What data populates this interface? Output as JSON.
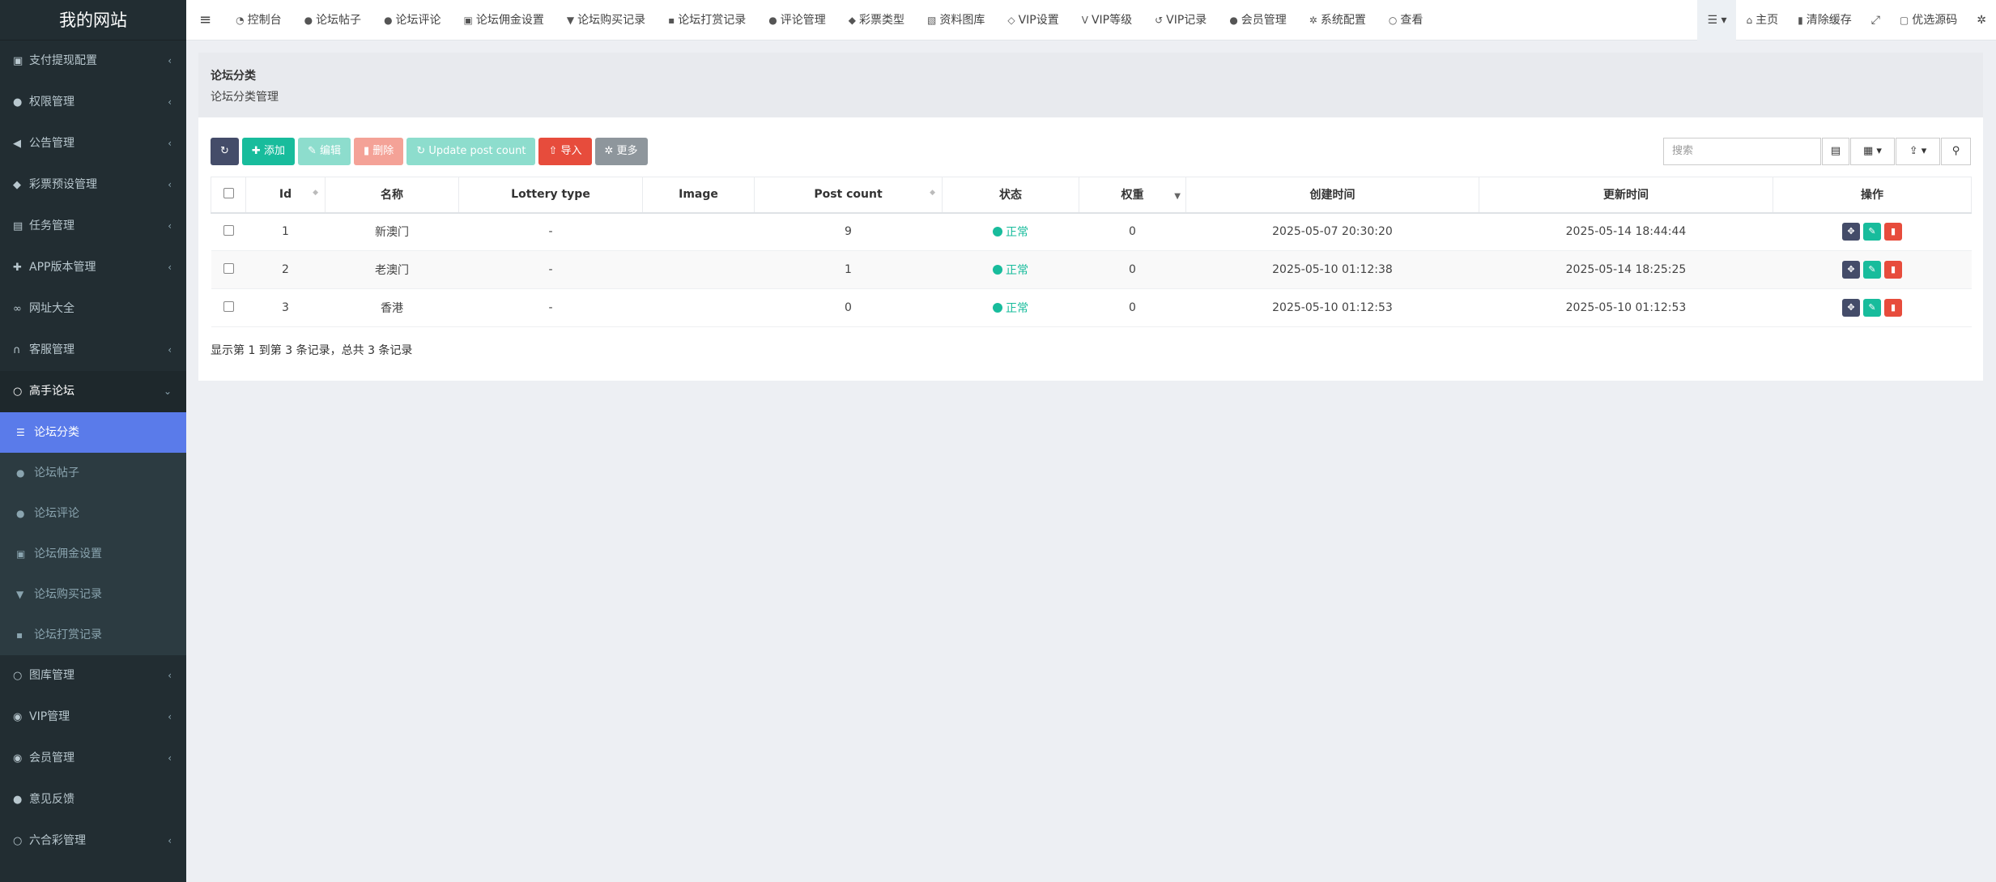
{
  "brand": "我的网站",
  "sidebar": {
    "top": [
      {
        "label": "支付提现配置",
        "icon": "money-icon"
      },
      {
        "label": "权限管理",
        "icon": "users-icon"
      },
      {
        "label": "公告管理",
        "icon": "bullhorn-icon"
      },
      {
        "label": "彩票预设管理",
        "icon": "ticket-icon"
      },
      {
        "label": "任务管理",
        "icon": "list-icon"
      },
      {
        "label": "APP版本管理",
        "icon": "puzzle-icon"
      },
      {
        "label": "网址大全",
        "icon": "link-icon"
      },
      {
        "label": "客服管理",
        "icon": "headset-icon"
      }
    ],
    "open": {
      "label": "高手论坛",
      "icon": "circle-icon"
    },
    "sub": [
      {
        "label": "论坛分类",
        "icon": "list-icon"
      },
      {
        "label": "论坛帖子",
        "icon": "comment-icon"
      },
      {
        "label": "论坛评论",
        "icon": "comments-icon"
      },
      {
        "label": "论坛佣金设置",
        "icon": "money-icon"
      },
      {
        "label": "论坛购买记录",
        "icon": "cart-icon"
      },
      {
        "label": "论坛打赏记录",
        "icon": "gift-icon"
      }
    ],
    "bottom": [
      {
        "label": "图库管理",
        "icon": "circle-icon"
      },
      {
        "label": "VIP管理",
        "icon": "vip-icon"
      },
      {
        "label": "会员管理",
        "icon": "user-icon"
      },
      {
        "label": "意见反馈",
        "icon": "comment-icon"
      },
      {
        "label": "六合彩管理",
        "icon": "circle-icon"
      }
    ]
  },
  "topnav": [
    {
      "label": "控制台",
      "icon": "dashboard-icon",
      "glyph": "◔"
    },
    {
      "label": "论坛帖子",
      "icon": "comment-icon",
      "glyph": "●"
    },
    {
      "label": "论坛评论",
      "icon": "comments-icon",
      "glyph": "●"
    },
    {
      "label": "论坛佣金设置",
      "icon": "money-icon",
      "glyph": "▣"
    },
    {
      "label": "论坛购买记录",
      "icon": "cart-icon",
      "glyph": "▼"
    },
    {
      "label": "论坛打赏记录",
      "icon": "gift-icon",
      "glyph": "▪"
    },
    {
      "label": "评论管理",
      "icon": "comments-icon",
      "glyph": "●"
    },
    {
      "label": "彩票类型",
      "icon": "ticket-icon",
      "glyph": "◆"
    },
    {
      "label": "资料图库",
      "icon": "image-icon",
      "glyph": "▧"
    },
    {
      "label": "VIP设置",
      "icon": "diamond-icon",
      "glyph": "◇"
    },
    {
      "label": "VIP等级",
      "icon": "vip-icon",
      "glyph": "V"
    },
    {
      "label": "VIP记录",
      "icon": "history-icon",
      "glyph": "↺"
    },
    {
      "label": "会员管理",
      "icon": "user-icon",
      "glyph": "●"
    },
    {
      "label": "系统配置",
      "icon": "gear-icon",
      "glyph": "✲"
    },
    {
      "label": "查看",
      "icon": "circle-icon",
      "glyph": "○"
    }
  ],
  "topright": {
    "home": "主页",
    "clear_cache": "清除缓存",
    "source": "优选源码"
  },
  "page": {
    "title": "论坛分类",
    "subtitle": "论坛分类管理"
  },
  "toolbar": {
    "add": "添加",
    "edit": "编辑",
    "delete": "删除",
    "update": "Update post count",
    "import": "导入",
    "more": "更多"
  },
  "search": {
    "placeholder": "搜索"
  },
  "table": {
    "headers": [
      "Id",
      "名称",
      "Lottery type",
      "Image",
      "Post count",
      "状态",
      "权重",
      "创建时间",
      "更新时间",
      "操作"
    ],
    "rows": [
      {
        "id": "1",
        "name": "新澳门",
        "lottery": "-",
        "image": "",
        "count": "9",
        "status": "正常",
        "weight": "0",
        "created": "2025-05-07 20:30:20",
        "updated": "2025-05-14 18:44:44"
      },
      {
        "id": "2",
        "name": "老澳门",
        "lottery": "-",
        "image": "",
        "count": "1",
        "status": "正常",
        "weight": "0",
        "created": "2025-05-10 01:12:38",
        "updated": "2025-05-14 18:25:25"
      },
      {
        "id": "3",
        "name": "香港",
        "lottery": "-",
        "image": "",
        "count": "0",
        "status": "正常",
        "weight": "0",
        "created": "2025-05-10 01:12:53",
        "updated": "2025-05-10 01:12:53"
      }
    ]
  },
  "footer": "显示第 1 到第 3 条记录，总共 3 条记录",
  "colors": {
    "sidebar": "#222d32",
    "active": "#5a7bea",
    "teal": "#18bc9c",
    "red": "#e74c3c",
    "dark": "#444c69"
  }
}
